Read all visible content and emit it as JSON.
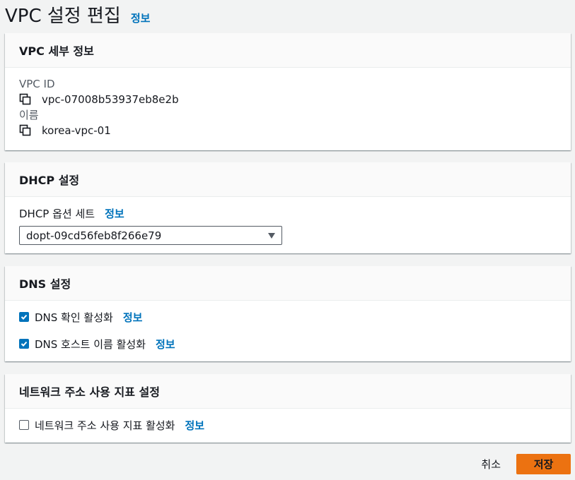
{
  "page": {
    "title": "VPC 설정 편집",
    "info_label": "정보"
  },
  "vpc_details": {
    "header": "VPC 세부 정보",
    "vpc_id_label": "VPC ID",
    "vpc_id_value": "vpc-07008b53937eb8e2b",
    "name_label": "이름",
    "name_value": "korea-vpc-01"
  },
  "dhcp": {
    "header": "DHCP 설정",
    "option_set_label": "DHCP 옵션 세트",
    "info_label": "정보",
    "selected_value": "dopt-09cd56feb8f266e79"
  },
  "dns": {
    "header": "DNS 설정",
    "resolution_label": "DNS 확인 활성화",
    "resolution_checked": true,
    "hostnames_label": "DNS 호스트 이름 활성화",
    "hostnames_checked": true,
    "info_label": "정보"
  },
  "network_metrics": {
    "header": "네트워크 주소 사용 지표 설정",
    "enable_label": "네트워크 주소 사용 지표 활성화",
    "enable_checked": false,
    "info_label": "정보"
  },
  "footer": {
    "cancel_label": "취소",
    "save_label": "저장"
  },
  "colors": {
    "link": "#0073bb",
    "primary_button": "#ec7211",
    "checkbox_checked": "#0073bb",
    "background": "#f2f3f3"
  },
  "icons": {
    "copy": "copy-icon",
    "checkmark": "check-icon",
    "dropdown": "caret-down-icon"
  }
}
